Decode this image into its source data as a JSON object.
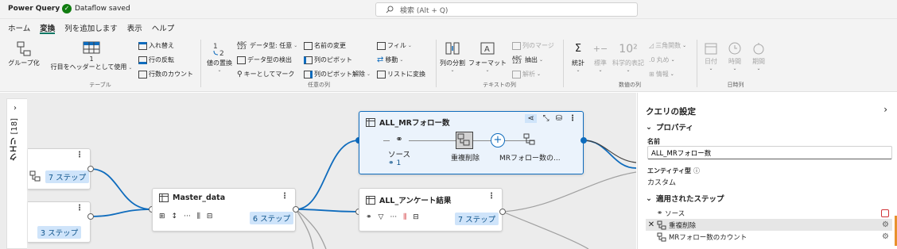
{
  "titlebar": {
    "app_name": "Power Query",
    "save_status": "Dataflow saved",
    "search_placeholder": "検索 (Alt + Q)"
  },
  "menu": {
    "tabs": [
      "ホーム",
      "変換",
      "列を追加します",
      "表示",
      "ヘルプ"
    ],
    "active_index": 1
  },
  "ribbon": {
    "table_group": {
      "label": "テーブル",
      "group_by": "グループ化",
      "use_first_row_num": "1",
      "use_first_row": "行目をヘッダーとして使用",
      "transpose": "入れ替え",
      "reverse_rows": "行の反転",
      "count_rows": "行数のカウント"
    },
    "any_column_group": {
      "label": "任意の列",
      "replace_values_1": "値の置換",
      "data_type": "データ型: 任意",
      "detect_type": "データ型の検出",
      "use_as_key": "キーとしてマーク",
      "rename": "名前の変更",
      "pivot": "列のピボット",
      "unpivot": "列のピボット解除",
      "fill": "フィル",
      "move": "移動",
      "to_list": "リストに変換"
    },
    "text_column_group": {
      "label": "テキストの列",
      "split": "列の分割",
      "format": "フォーマット",
      "merge": "列のマージ",
      "extract": "抽出",
      "parse": "解析"
    },
    "number_column_group": {
      "label": "数値の列",
      "statistics": "統計",
      "standard": "標準",
      "scientific": "科学的表記",
      "trig": "三角関数",
      "rounding": "丸め",
      "info": "情報"
    },
    "datetime_group": {
      "label": "日時列",
      "date": "日付",
      "time": "時間",
      "duration": "期間"
    }
  },
  "canvas": {
    "query_panel": {
      "label": "クエリ",
      "count": "[18]"
    },
    "nodes": {
      "top_left": {
        "steps": "7 ステップ"
      },
      "bottom_left": {
        "steps": "3 ステップ"
      },
      "master": {
        "title": "Master_data",
        "steps": "6 ステップ"
      },
      "mr_follow": {
        "title": "ALL_MRフォロー数",
        "step_source": "ソース",
        "step_source_count": "1",
        "step_dedupe": "重複削除",
        "step_count": "MRフォロー数の..."
      },
      "survey": {
        "title": "ALL_アンケート結果",
        "steps": "7 ステップ"
      }
    }
  },
  "settings": {
    "title": "クエリの設定",
    "properties": "プロパティ",
    "name_label": "名前",
    "name_value": "ALL_MRフォロー数",
    "entity_type_label": "エンティティ型",
    "entity_type_value": "カスタム",
    "applied_steps": "適用されたステップ",
    "steps": [
      "ソース",
      "重複削除",
      "MRフォロー数のカウント"
    ]
  },
  "colors": {
    "accent": "#0f6cbd",
    "tab_underline": "#117865",
    "selected_node_bg": "#ebf3fc",
    "badge_bg": "#cfe4fa"
  }
}
